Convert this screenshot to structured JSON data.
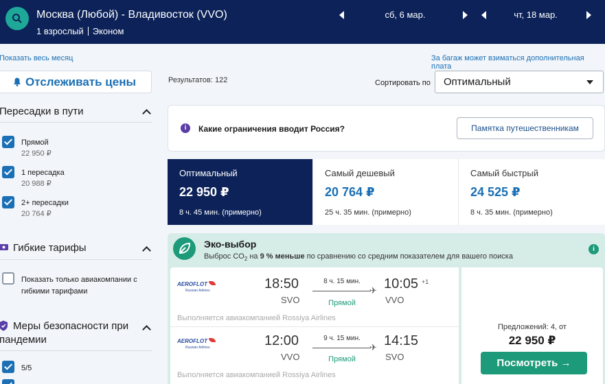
{
  "header": {
    "route": "Москва (Любой) - Владивосток (VVO)",
    "passengers": "1 взрослый",
    "cabin": "Эконом",
    "depart_date": "сб, 6 мар.",
    "return_date": "чт, 18 мар.",
    "icons": [
      "search-icon",
      "chevron-left-icon",
      "chevron-right-icon"
    ]
  },
  "links": {
    "show_month": "Показать весь месяц",
    "baggage": "За багаж может взиматься дополнительная плата"
  },
  "sidebar": {
    "track_prices": "Отслеживать цены",
    "stops": {
      "title": "Пересадки в пути",
      "options": [
        {
          "label": "Прямой",
          "price": "22 950 ₽",
          "checked": true
        },
        {
          "label": "1 пересадка",
          "price": "20 988 ₽",
          "checked": true
        },
        {
          "label": "2+ пересадки",
          "price": "20 764 ₽",
          "checked": true
        }
      ]
    },
    "flexible": {
      "title": "Гибкие тарифы",
      "option_line1": "Показать только авиакомпании с",
      "option_line2": "гибкими тарифами",
      "checked": false
    },
    "safety": {
      "title_line1": "Меры безопасности при",
      "title_line2": "пандемии",
      "options": [
        {
          "label": "5/5",
          "checked": true
        }
      ]
    }
  },
  "main": {
    "results": "Результатов: 122",
    "sort_label": "Сортировать по",
    "sort_value": "Оптимальный",
    "notice": {
      "text": "Какие ограничения вводит Россия?",
      "button": "Памятка путешественникам"
    },
    "tabs": [
      {
        "title": "Оптимальный",
        "price": "22 950 ₽",
        "duration": "8 ч. 45 мин. (примерно)",
        "active": true
      },
      {
        "title": "Самый дешевый",
        "price": "20 764 ₽",
        "duration": "25 ч. 35 мин. (примерно)",
        "active": false
      },
      {
        "title": "Самый быстрый",
        "price": "24 525 ₽",
        "duration": "8 ч. 35 мин. (примерно)",
        "active": false
      }
    ],
    "eco": {
      "title": "Эко-выбор",
      "sub_before": "Выброс CO",
      "sub_sub": "2",
      "sub_mid": " на ",
      "sub_bold": "9 % меньше",
      "sub_after": " по сравнению со средним показателем для вашего поиска"
    },
    "flights": [
      {
        "airline": "AEROFLOT",
        "airline_sub": "Russian Airlines",
        "dep_time": "18:50",
        "dep_apt": "SVO",
        "duration": "8 ч. 15 мин.",
        "stops": "Прямой",
        "arr_time": "10:05",
        "arr_plus": "+1",
        "arr_apt": "VVO",
        "operated": "Выполняется авиакомпанией Rossiya Airlines"
      },
      {
        "airline": "AEROFLOT",
        "airline_sub": "Russian Airlines",
        "dep_time": "12:00",
        "dep_apt": "VVO",
        "duration": "9 ч. 15 мин.",
        "stops": "Прямой",
        "arr_time": "14:15",
        "arr_plus": "",
        "arr_apt": "SVO",
        "operated": "Выполняется авиакомпанией Rossiya Airlines"
      }
    ],
    "offer": {
      "count": "Предложений: 4, от",
      "price": "22 950 ₽",
      "button": "Посмотреть →"
    }
  },
  "colors": {
    "navy": "#0c2258",
    "teal": "#1c9a79",
    "blue": "#1a6fb5"
  }
}
